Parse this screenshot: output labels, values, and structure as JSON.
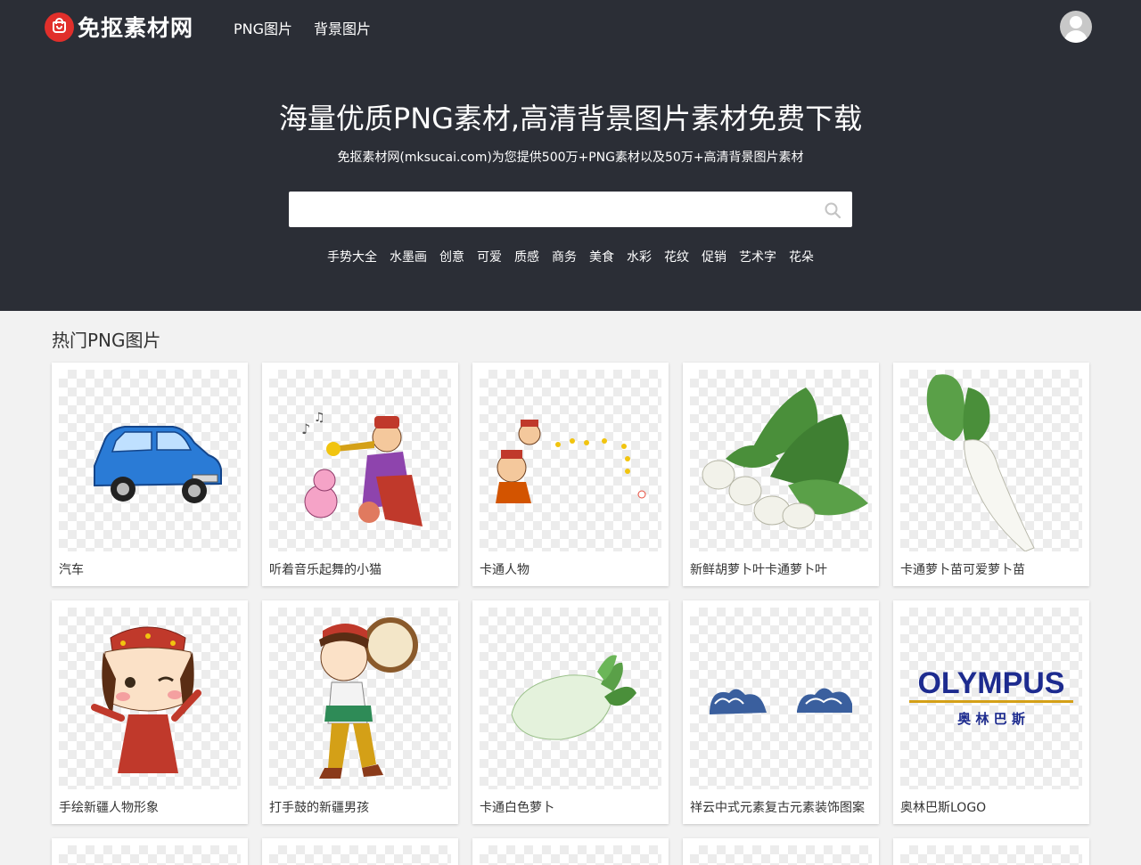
{
  "header": {
    "logo_text": "免抠素材网",
    "nav": [
      {
        "label": "PNG图片"
      },
      {
        "label": "背景图片"
      }
    ]
  },
  "hero": {
    "title": "海量优质PNG素材,高清背景图片素材免费下载",
    "subtitle": "免抠素材网(mksucai.com)为您提供500万+PNG素材以及50万+高清背景图片素材",
    "search": {
      "value": "",
      "placeholder": ""
    },
    "tags": [
      "手势大全",
      "水墨画",
      "创意",
      "可爱",
      "质感",
      "商务",
      "美食",
      "水彩",
      "花纹",
      "促销",
      "艺术字",
      "花朵"
    ]
  },
  "section": {
    "title": "热门PNG图片",
    "items": [
      {
        "label": "汽车",
        "icon": "car-image"
      },
      {
        "label": "听着音乐起舞的小猫",
        "icon": "cat-trumpet-image"
      },
      {
        "label": "卡通人物",
        "icon": "cartoon-people-image"
      },
      {
        "label": "新鲜胡萝卜叶卡通萝卜叶",
        "icon": "turnip-leaves-image"
      },
      {
        "label": "卡通萝卜苗可爱萝卜苗",
        "icon": "radish-sprout-image"
      },
      {
        "label": "手绘新疆人物形象",
        "icon": "xinjiang-girl-image"
      },
      {
        "label": "打手鼓的新疆男孩",
        "icon": "drum-boy-image"
      },
      {
        "label": "卡通白色萝卜",
        "icon": "white-radish-image"
      },
      {
        "label": "祥云中式元素复古元素装饰图案",
        "icon": "auspicious-cloud-image"
      },
      {
        "label": "奥林巴斯LOGO",
        "icon": "olympus-logo-image"
      }
    ]
  },
  "olympus_logo": {
    "word": "OLYMPUS",
    "cn": "奥 林 巴 斯"
  },
  "colors": {
    "hero_bg": "#2b2e36",
    "brand_red": "#e12f2b",
    "page_bg": "#f2f2f2"
  }
}
